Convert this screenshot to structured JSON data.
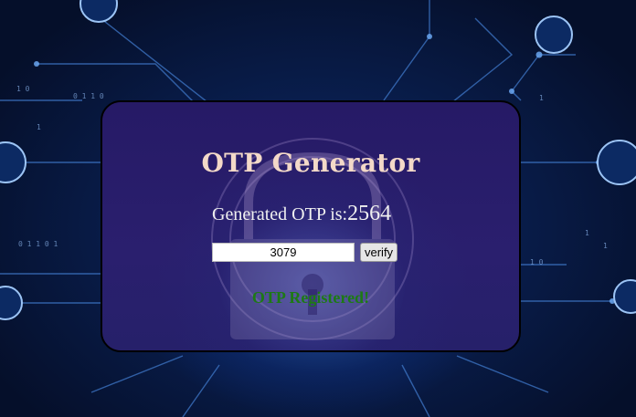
{
  "card": {
    "title": "OTP Generator",
    "generated_label": "Generated OTP is:",
    "generated_value": "2564",
    "input_value": "3079",
    "verify_label": "verify",
    "status_text": "OTP Registered!"
  },
  "colors": {
    "title": "#f3d9c8",
    "status": "#1d7a14",
    "card_bg": "#261a66"
  }
}
